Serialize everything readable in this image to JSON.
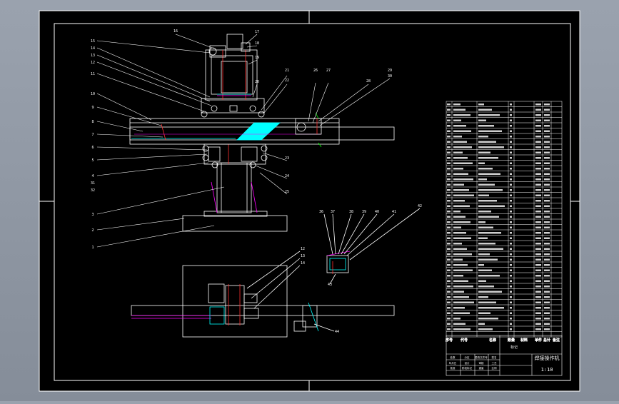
{
  "viewer": {
    "background": "#8f97a3",
    "paper_color": "#000000",
    "line_color": "#ffffff",
    "accent_colors": [
      "#00ffff",
      "#ff00ff",
      "#ff3030",
      "#ffff00",
      "#00ff00"
    ]
  },
  "drawing": {
    "callouts_main": [
      "1",
      "2",
      "3",
      "4",
      "5",
      "6",
      "7",
      "8",
      "9",
      "10",
      "11",
      "12",
      "13",
      "14",
      "15",
      "16",
      "17",
      "18",
      "19",
      "20",
      "21",
      "22",
      "23",
      "24",
      "25",
      "26",
      "27",
      "28",
      "29",
      "30",
      "31",
      "32",
      "33",
      "34",
      "35",
      "36"
    ],
    "callouts_section": [
      "36",
      "37",
      "38",
      "39",
      "40",
      "41",
      "42",
      "43"
    ],
    "callouts_plan": [
      "12",
      "13",
      "14",
      "44",
      "45"
    ]
  },
  "parts_list": {
    "row_count": 44,
    "header": [
      "序号",
      "代号",
      "名称",
      "数量",
      "材料",
      "单件",
      "总计",
      "备注"
    ]
  },
  "title_block": {
    "drawing_name": "焊接操作机",
    "drawing_number": "1:10",
    "labels": [
      "标记",
      "处数",
      "分区",
      "更改文件号",
      "签名",
      "年月日",
      "设计",
      "审核",
      "工艺",
      "批准",
      "阶段标记",
      "重量",
      "比例"
    ]
  }
}
